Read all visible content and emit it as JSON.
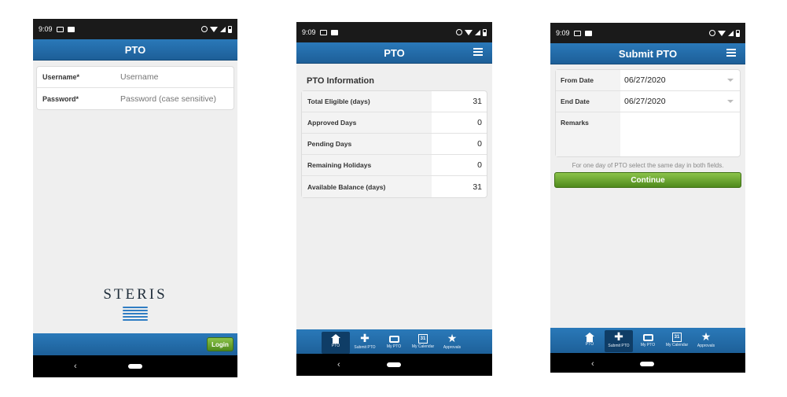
{
  "status": {
    "time": "9:09"
  },
  "login": {
    "title": "PTO",
    "username_label": "Username*",
    "username_placeholder": "Username",
    "password_label": "Password*",
    "password_placeholder": "Password (case sensitive)",
    "brand": "STERIS",
    "login_label": "Login"
  },
  "info": {
    "title": "PTO",
    "section_title": "PTO Information",
    "rows": [
      {
        "label": "Total Eligible (days)",
        "value": "31"
      },
      {
        "label": "Approved Days",
        "value": "0"
      },
      {
        "label": "Pending Days",
        "value": "0"
      },
      {
        "label": "Remaining Holidays",
        "value": "0"
      },
      {
        "label": "Available Balance (days)",
        "value": "31"
      }
    ]
  },
  "submit": {
    "title": "Submit PTO",
    "from_label": "From Date",
    "from_value": "06/27/2020",
    "end_label": "End Date",
    "end_value": "06/27/2020",
    "remarks_label": "Remarks",
    "hint": "For one day of PTO select the same day in both fields.",
    "continue_label": "Continue"
  },
  "tabs": [
    {
      "label": "PTO",
      "icon": "home-icon"
    },
    {
      "label": "Submit PTO",
      "icon": "plus-icon"
    },
    {
      "label": "My PTO",
      "icon": "tray-icon"
    },
    {
      "label": "My Calendar",
      "icon": "calendar-icon",
      "day": "31"
    },
    {
      "label": "Approvals",
      "icon": "star-icon"
    }
  ],
  "colors": {
    "header": "#2a79b9",
    "button": "#6aa62f",
    "active_tab": "#0f3d66"
  }
}
